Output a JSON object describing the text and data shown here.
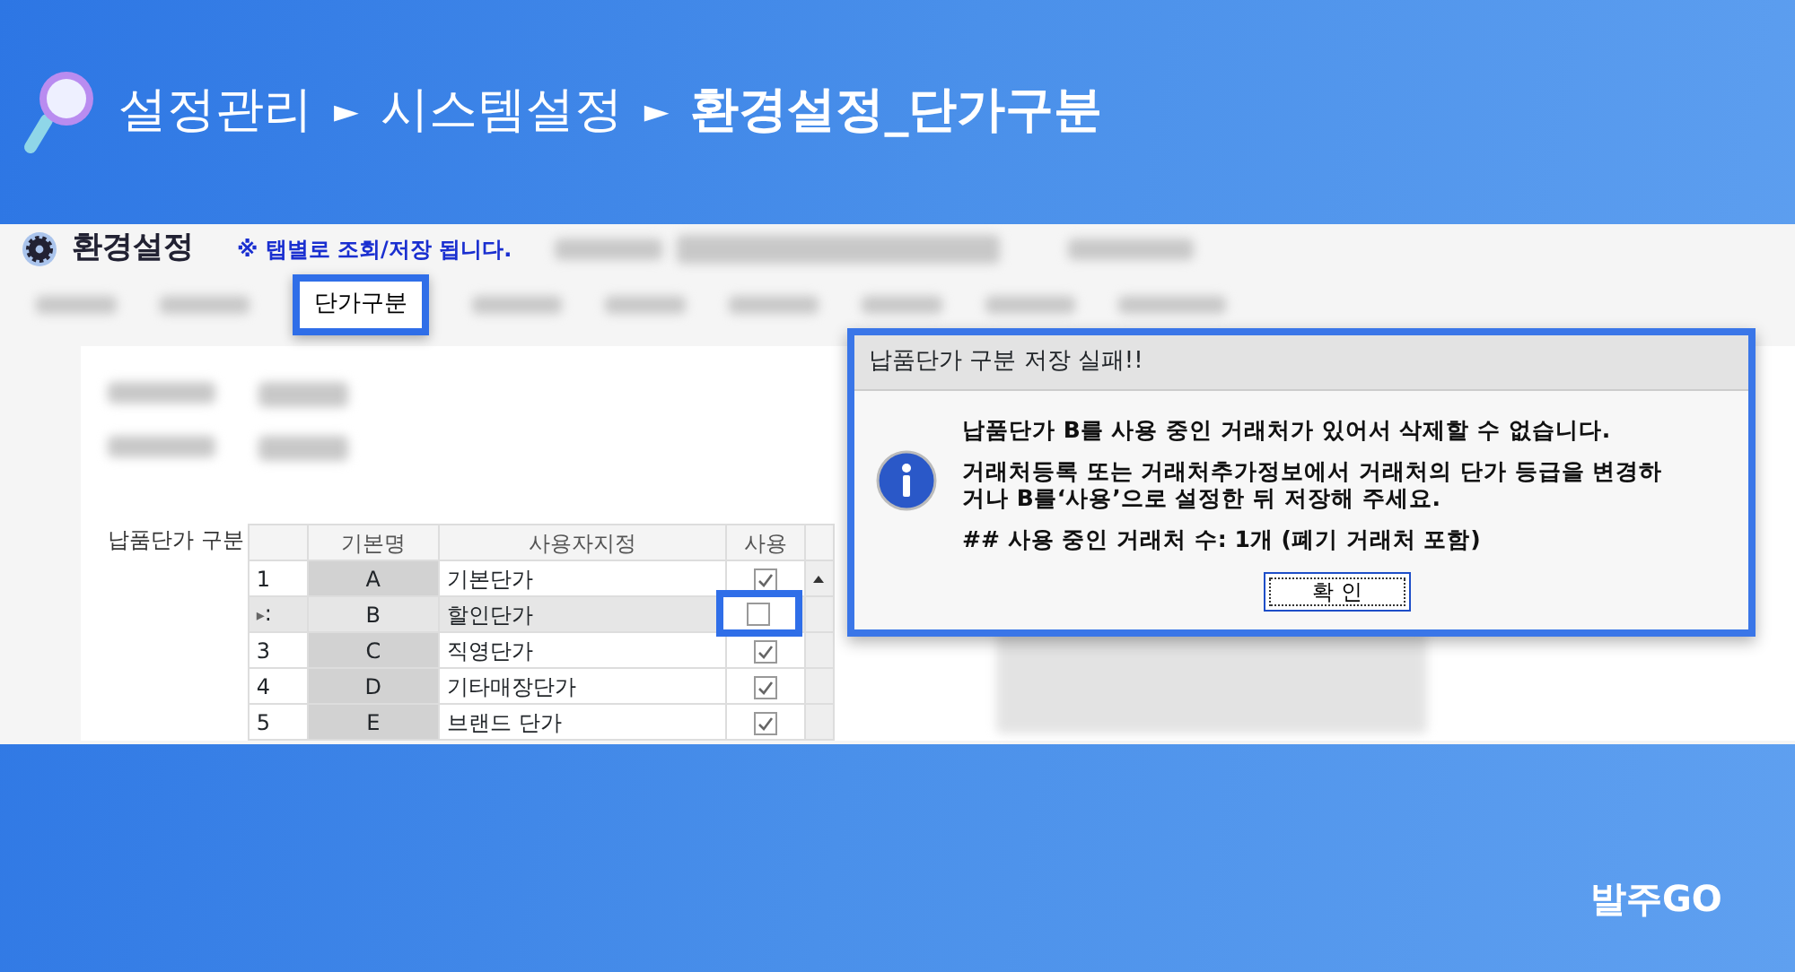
{
  "breadcrumb": [
    {
      "label": "설정관리",
      "current": false
    },
    {
      "label": "시스템설정",
      "current": false
    },
    {
      "label": "환경설정_단가구분",
      "current": true
    }
  ],
  "breadcrumb_separators": [
    "►",
    "►"
  ],
  "app": {
    "title": "환경설정",
    "notice": "※ 탭별로 조회/저장 됩니다.",
    "tab": {
      "label": "단가구분",
      "highlighted": true
    },
    "grid_label": "납품단가 구분",
    "columns": [
      "기본명",
      "사용자지정",
      "사용"
    ],
    "rows": [
      {
        "index": "1",
        "base": "A",
        "custom": "기본단가",
        "used": true,
        "selected": false,
        "highlighted": false
      },
      {
        "pointer": "▸",
        "index": ":",
        "base": "B",
        "custom": "할인단가",
        "used": false,
        "selected": true,
        "highlighted": true
      },
      {
        "index": "3",
        "base": "C",
        "custom": "직영단가",
        "used": true,
        "selected": false,
        "highlighted": false
      },
      {
        "index": "4",
        "base": "D",
        "custom": "기타매장단가",
        "used": true,
        "selected": false,
        "highlighted": false
      },
      {
        "index": "5",
        "base": "E",
        "custom": "브랜드 단가",
        "used": true,
        "selected": false,
        "highlighted": false
      }
    ]
  },
  "dialog": {
    "title": "납품단가 구분 저장 실패!!",
    "messages": [
      "납품단가 B를 사용 중인 거래처가 있어서 삭제할 수 없습니다.",
      "거래처등록 또는 거래처추가정보에서 거래처의 단가 등급을 변경하거나 B를‘사용’으로 설정한 뒤 저장해 주세요.",
      "## 사용 중인 거래처 수: 1개 (폐기 거래처 포함)"
    ],
    "ok_button": "확 인"
  },
  "logo": "발주GO"
}
